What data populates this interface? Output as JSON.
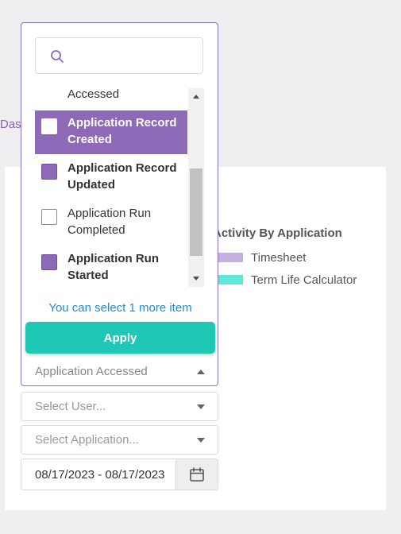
{
  "breadcrumb": {
    "text": "Das"
  },
  "chart": {
    "legend_title": "Activity By Application",
    "legend": [
      {
        "label": "Timesheet",
        "color": "#c4b1df"
      },
      {
        "label": "Term Life Calculator",
        "color": "#5ee8d8"
      }
    ]
  },
  "dropdown": {
    "search": {
      "placeholder": "",
      "icon": "search-icon"
    },
    "options": [
      {
        "label": "Accessed",
        "checked": false,
        "active": false,
        "bold": false,
        "partial": true
      },
      {
        "label": "Application Record Created",
        "checked": false,
        "active": true,
        "bold": true
      },
      {
        "label": "Application Record Updated",
        "checked": true,
        "active": false,
        "bold": true
      },
      {
        "label": "Application Run Completed",
        "checked": false,
        "active": false,
        "bold": false
      },
      {
        "label": "Application Run Started",
        "checked": true,
        "active": false,
        "bold": true
      }
    ],
    "limit_message": "You can select 1 more item",
    "apply_label": "Apply",
    "selected_value": "Application Accessed"
  },
  "filters": {
    "user_placeholder": "Select User...",
    "application_placeholder": "Select Application...",
    "date_range": "08/17/2023 - 08/17/2023"
  },
  "colors": {
    "accent": "#8d69b7",
    "apply": "#1ec8b4",
    "link": "#1e8dd6"
  }
}
